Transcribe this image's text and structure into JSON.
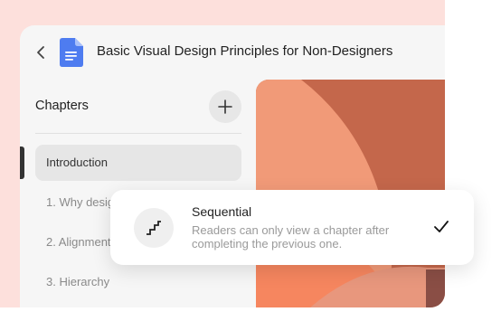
{
  "header": {
    "title": "Basic Visual Design Principles for Non-Designers",
    "back_icon": "chevron-left-icon",
    "doc_icon": "document-icon"
  },
  "sidebar": {
    "heading": "Chapters",
    "add_icon": "plus-icon",
    "items": [
      {
        "label": "Introduction",
        "active": true
      },
      {
        "label": "1. Why design matters",
        "active": false
      },
      {
        "label": "2. Alignment",
        "active": false
      },
      {
        "label": "3. Hierarchy",
        "active": false
      }
    ]
  },
  "popup": {
    "icon": "stairs-icon",
    "title": "Sequential",
    "description": "Readers can only view a chapter after completing the previous one.",
    "selected": true,
    "check_icon": "checkmark-icon"
  },
  "colors": {
    "background_blob": "#fde0dc",
    "window_bg": "#f6f6f6",
    "doc_icon_blue": "#4e7cf0",
    "cover_orange": "#f19a78",
    "cover_brown": "#c4674b"
  }
}
